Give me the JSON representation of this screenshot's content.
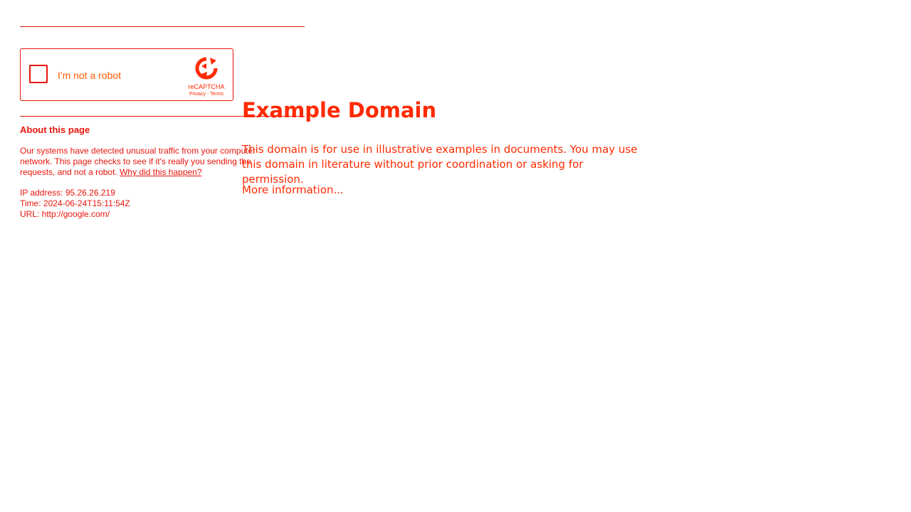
{
  "recaptcha": {
    "checkbox_label": "I'm not a robot",
    "brand": "reCAPTCHA",
    "privacy_link": "Privacy",
    "separator": " - ",
    "terms_link": "Terms",
    "logo_icon": "recaptcha-logo-icon"
  },
  "about": {
    "title": "About this page",
    "text": "Our systems have detected unusual traffic from your computer network. This page checks to see if it's really you sending the requests, and not a robot.",
    "why_link": "Why did this happen?"
  },
  "info": {
    "ip": "IP address: 95.26.26.219",
    "time": "Time: 2024-06-24T15:11:54Z",
    "url": "URL: http://google.com/"
  },
  "domain": {
    "title": "Example Domain",
    "text": "This domain is for use in illustrative examples in documents. You may use this domain in literature without prior coordination or asking for permission.",
    "more_link": "More information..."
  },
  "colors": {
    "primary": "#ff2a00",
    "secondary": "#e8140c",
    "background": "#ffffff"
  }
}
